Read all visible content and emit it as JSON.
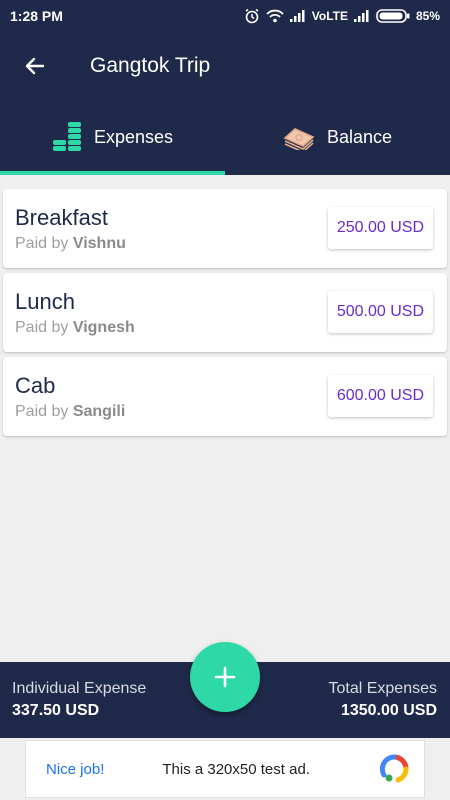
{
  "status_bar": {
    "time": "1:28 PM",
    "network": "VoLTE",
    "battery": "85%"
  },
  "header": {
    "title": "Gangtok Trip"
  },
  "tabs": [
    {
      "label": "Expenses",
      "icon": "coins-stack-icon",
      "active": true
    },
    {
      "label": "Balance",
      "icon": "money-bills-icon",
      "active": false
    }
  ],
  "expenses": [
    {
      "name": "Breakfast",
      "paid_by_prefix": "Paid by",
      "paid_by": "Vishnu",
      "amount": "250.00 USD"
    },
    {
      "name": "Lunch",
      "paid_by_prefix": "Paid by",
      "paid_by": "Vignesh",
      "amount": "500.00 USD"
    },
    {
      "name": "Cab",
      "paid_by_prefix": "Paid by",
      "paid_by": "Sangili",
      "amount": "600.00 USD"
    }
  ],
  "footer": {
    "individual_label": "Individual Expense",
    "individual_value": "337.50 USD",
    "total_label": "Total Expenses",
    "total_value": "1350.00 USD"
  },
  "ad": {
    "nice": "Nice job!",
    "text": "This a 320x50 test ad."
  },
  "colors": {
    "primary": "#1f2a4a",
    "accent": "#2ed8a7",
    "amount": "#6a2bd0"
  }
}
